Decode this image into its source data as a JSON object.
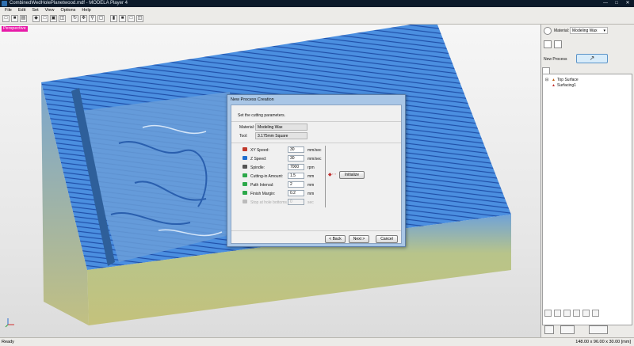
{
  "window": {
    "title": "CombinedWedHolePlanetwood.mdf - MODELA Player 4"
  },
  "menu": [
    "File",
    "Edit",
    "Set",
    "View",
    "Options",
    "Help"
  ],
  "toolbar_icons": [
    "open-icon",
    "save-icon",
    "print-icon",
    "view-3d-icon",
    "view-top-icon",
    "view-front-icon",
    "view-right-icon",
    "rotate-icon",
    "pan-icon",
    "zoom-icon",
    "zoom-fit-icon",
    "cube-iso-icon",
    "cube-solid-icon",
    "cube-wire-icon",
    "cube-cut-icon"
  ],
  "viewport": {
    "label": "Perspective"
  },
  "right_panel": {
    "material_label": "Material:",
    "material_value": "Modeling Wax",
    "new_process_label": "New Process",
    "tree": {
      "root": "Top Surface",
      "child": "Surfacing1"
    }
  },
  "dialog": {
    "title": "New Process Creation",
    "instruction": "Set the cutting parameters.",
    "material_label": "Material:",
    "material_value": "Modeling Wax",
    "tool_label": "Tool:",
    "tool_value": "3.175mm Square",
    "params": [
      {
        "label": "XY Speed:",
        "value": "30",
        "unit": "mm/sec",
        "enabled": true,
        "color": "#c0392b"
      },
      {
        "label": "Z Speed:",
        "value": "30",
        "unit": "mm/sec",
        "enabled": true,
        "color": "#1f6fd0"
      },
      {
        "label": "Spindle:",
        "value": "7000",
        "unit": "rpm",
        "enabled": true,
        "color": "#555555"
      },
      {
        "label": "Cutting-in Amount:",
        "value": "1.5",
        "unit": "mm",
        "enabled": true,
        "color": "#2ca84a"
      },
      {
        "label": "Path Interval:",
        "value": "2",
        "unit": "mm",
        "enabled": true,
        "color": "#2ca84a"
      },
      {
        "label": "Finish Margin:",
        "value": "0.2",
        "unit": "mm",
        "enabled": true,
        "color": "#2ca84a"
      },
      {
        "label": "Stop at hole bottoms",
        "value": "0",
        "unit": "sec",
        "enabled": false,
        "color": "#bbbbbb"
      }
    ],
    "initialize_label": "Initialize",
    "back_label": "< Back",
    "next_label": "Next >",
    "cancel_label": "Cancel"
  },
  "status": {
    "left": "Ready",
    "right": "148.00 x 96.00 x 30.00 [mm]"
  }
}
